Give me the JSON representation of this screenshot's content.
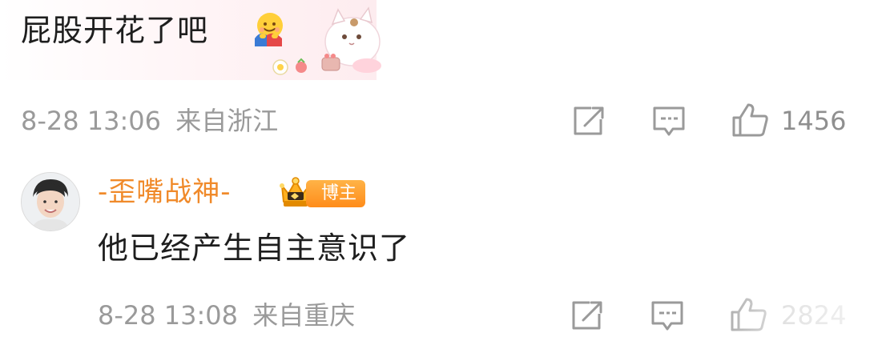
{
  "comments": [
    {
      "text": "屁股开花了吧",
      "emoji": "hugging-face-icon",
      "sticker": "white-cat-sticker",
      "time": "8-28 13:06",
      "location": "来自浙江",
      "likes": "1456"
    },
    {
      "username": "-歪嘴战神-",
      "badge": "博主",
      "text": "他已经产生自主意识了",
      "time": "8-28 13:08",
      "location": "来自重庆",
      "likes": "2824"
    }
  ],
  "icons": {
    "share": "share-icon",
    "comment": "comment-icon",
    "like": "thumbs-up-icon",
    "crown": "crown-icon"
  },
  "colors": {
    "text": "#1e1e1e",
    "meta": "#9a9a9a",
    "username": "#f08a2a",
    "badge": "#ff8c1a"
  }
}
